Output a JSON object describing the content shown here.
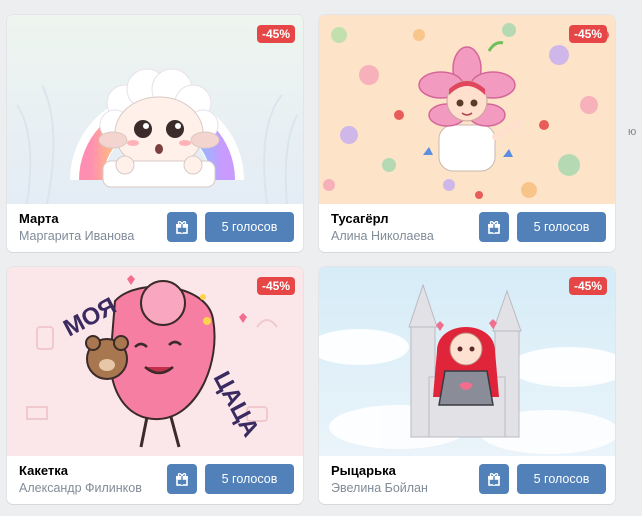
{
  "badge_color": "#e64646",
  "button_color": "#5181b8",
  "edge_fragment": "ю",
  "cards": [
    {
      "title": "Марта",
      "author": "Маргарита Иванова",
      "discount": "-45%",
      "vote_label": "5 голосов",
      "gift_icon": "gift-icon"
    },
    {
      "title": "Тусагёрл",
      "author": "Алина Николаева",
      "discount": "-45%",
      "vote_label": "5 голосов",
      "gift_icon": "gift-icon"
    },
    {
      "title": "Какетка",
      "author": "Александр Филинков",
      "discount": "-45%",
      "vote_label": "5 голосов",
      "gift_icon": "gift-icon",
      "art_text": [
        "МОЯ",
        "ЦАЦА"
      ]
    },
    {
      "title": "Рыцарька",
      "author": "Эвелина Бойлан",
      "discount": "-45%",
      "vote_label": "5 голосов",
      "gift_icon": "gift-icon"
    }
  ]
}
